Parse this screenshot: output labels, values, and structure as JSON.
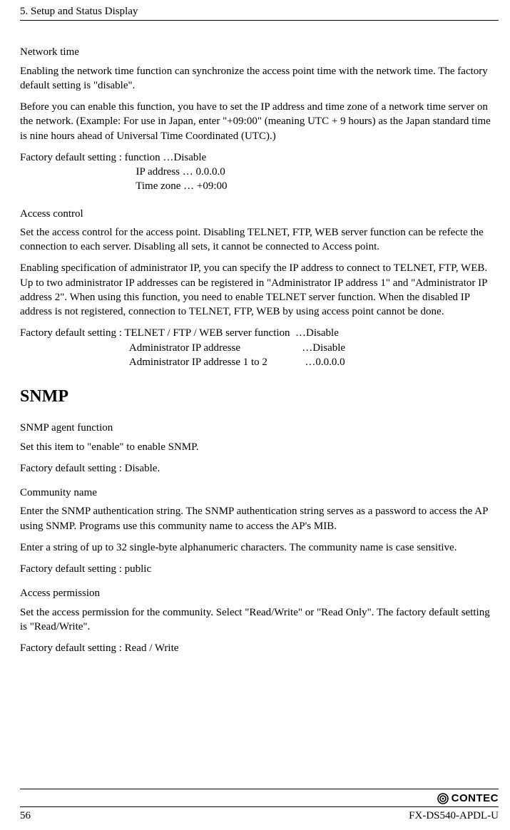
{
  "header": {
    "chapter": "5. Setup and Status Display"
  },
  "network_time": {
    "title": "Network time",
    "p1": "Enabling the network time function can synchronize the access point time with the network time.  The factory default setting is \"disable\".",
    "p2": "Before you can enable this function, you have to set the IP address and time zone of a network time server on the network.  (Example: For use in Japan, enter \"+09:00\" (meaning UTC + 9 hours) as the Japan standard time is nine hours ahead of Universal Time Coordinated (UTC).)",
    "defaults_line1": "Factory default setting : function …Disable",
    "defaults_line2": "  IP address … 0.0.0.0",
    "defaults_line3": "  Time zone … +09:00"
  },
  "access_control": {
    "title": "Access control",
    "p1": "Set the access control for the access point.  Disabling TELNET, FTP, WEB server function can be refecte the connection to each server.  Disabling all sets, it cannot be connected to Access point.",
    "p2": "Enabling specification of administrator IP, you can specify the IP address to connect to TELNET, FTP, WEB.  Up to two administrator IP addresses can be registered in \"Administrator IP address 1\" and \"Administrator IP address 2\".  When using this function, you need to enable TELNET server function.  When the disabled IP address is not registered, connection to TELNET, FTP, WEB by using access point cannot be done.",
    "defaults_line1": "Factory default setting : TELNET / FTP / WEB server function  …Disable",
    "defaults_line2": " Administrator IP addresse                       …Disable",
    "defaults_line3": " Administrator IP addresse 1 to 2              …0.0.0.0"
  },
  "snmp_heading": "SNMP",
  "snmp_agent": {
    "title": "SNMP agent function",
    "p1": "Set this item to \"enable\" to enable SNMP.",
    "p2": "Factory default setting : Disable."
  },
  "community": {
    "title": "Community name",
    "p1": "Enter the SNMP authentication string.  The SNMP authentication string serves as a password to access the AP using SNMP.  Programs use this community name to access the AP's MIB.",
    "p2": "Enter a string of up to 32 single-byte alphanumeric characters.  The community name is case sensitive.",
    "p3": "Factory default setting : public"
  },
  "access_permission": {
    "title": "Access permission",
    "p1": "Set the access permission for the community.  Select \"Read/Write\" or \"Read Only\".  The factory default setting is \"Read/Write\".",
    "p2": "Factory default setting : Read / Write"
  },
  "footer": {
    "brand": "CONTEC",
    "page": "56",
    "model": "FX-DS540-APDL-U"
  }
}
